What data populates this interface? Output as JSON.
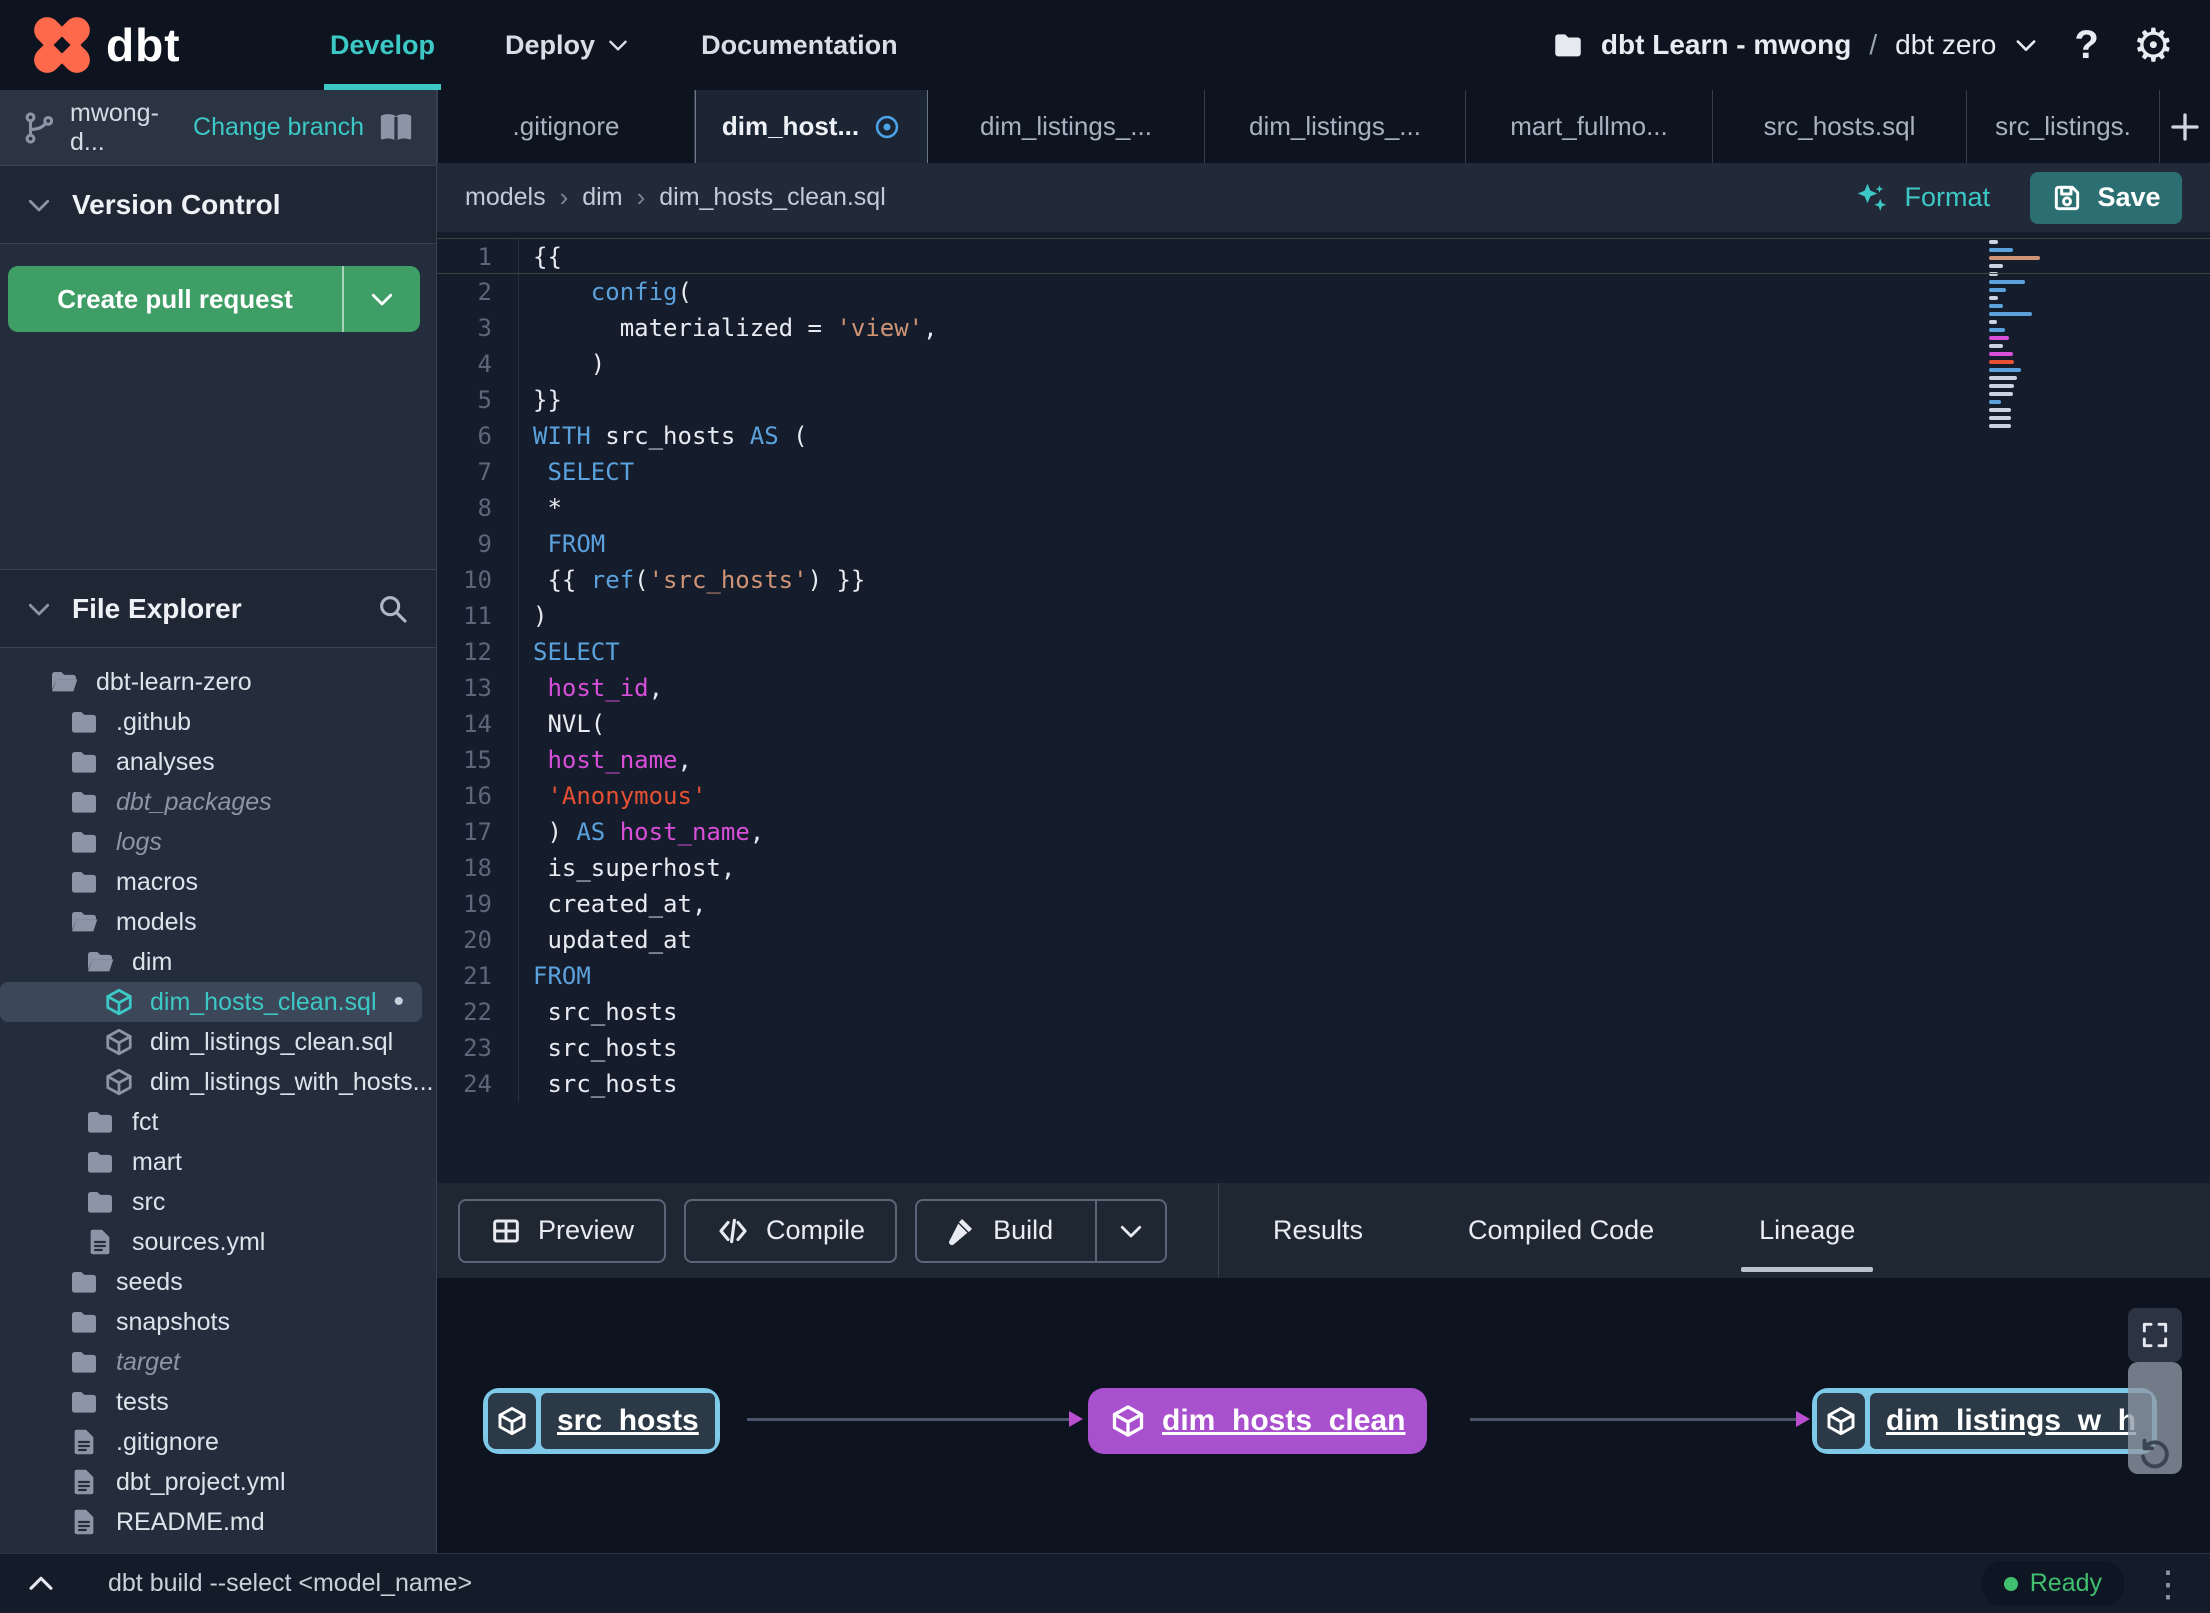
{
  "colors": {
    "accent_teal": "#3cc8c5",
    "green": "#3f9e66",
    "save_teal": "#2c6f72",
    "purple_node": "#a950ce",
    "blue_node": "#7ec8e8",
    "ready_green": "#3fbf6f",
    "keyword_blue": "#5ba2dd",
    "string_salmon": "#cf9475",
    "string_red": "#e55033",
    "identifier_magenta": "#d94fd9",
    "dirty_blue": "#4da3e8",
    "logo_orange": "#ff694b"
  },
  "topbar": {
    "brand": "dbt",
    "nav": [
      {
        "label": "Develop",
        "active": true,
        "dropdown": false
      },
      {
        "label": "Deploy",
        "active": false,
        "dropdown": true
      },
      {
        "label": "Documentation",
        "active": false,
        "dropdown": false
      }
    ],
    "project": {
      "account": "dbt Learn - mwong",
      "separator": "/",
      "name": "dbt zero"
    },
    "help": "?"
  },
  "sidebar": {
    "branch": {
      "name": "mwong-d...",
      "change_branch": "Change branch"
    },
    "version_control": {
      "title": "Version Control",
      "create_pr": "Create pull request"
    },
    "file_explorer": {
      "title": "File Explorer",
      "tree": [
        {
          "name": "dbt-learn-zero",
          "type": "folder-open",
          "level": 0
        },
        {
          "name": ".github",
          "type": "folder",
          "level": 1
        },
        {
          "name": "analyses",
          "type": "folder",
          "level": 1
        },
        {
          "name": "dbt_packages",
          "type": "folder",
          "level": 1,
          "italic": true
        },
        {
          "name": "logs",
          "type": "folder",
          "level": 1,
          "italic": true
        },
        {
          "name": "macros",
          "type": "folder",
          "level": 1
        },
        {
          "name": "models",
          "type": "folder-open",
          "level": 1
        },
        {
          "name": "dim",
          "type": "folder-open",
          "level": 2
        },
        {
          "name": "dim_hosts_clean.sql",
          "type": "model",
          "level": 3,
          "selected": true,
          "dirty": true
        },
        {
          "name": "dim_listings_clean.sql",
          "type": "model",
          "level": 3
        },
        {
          "name": "dim_listings_with_hosts...",
          "type": "model",
          "level": 3
        },
        {
          "name": "fct",
          "type": "folder",
          "level": 2
        },
        {
          "name": "mart",
          "type": "folder",
          "level": 2
        },
        {
          "name": "src",
          "type": "folder",
          "level": 2
        },
        {
          "name": "sources.yml",
          "type": "file",
          "level": 2
        },
        {
          "name": "seeds",
          "type": "folder",
          "level": 1
        },
        {
          "name": "snapshots",
          "type": "folder",
          "level": 1
        },
        {
          "name": "target",
          "type": "folder",
          "level": 1,
          "italic": true
        },
        {
          "name": "tests",
          "type": "folder",
          "level": 1
        },
        {
          "name": ".gitignore",
          "type": "file",
          "level": 1
        },
        {
          "name": "dbt_project.yml",
          "type": "file",
          "level": 1
        },
        {
          "name": "README.md",
          "type": "file",
          "level": 1
        }
      ]
    }
  },
  "tabs": [
    {
      "label": ".gitignore"
    },
    {
      "label": "dim_host...",
      "active": true,
      "dirty": true
    },
    {
      "label": "dim_listings_..."
    },
    {
      "label": "dim_listings_..."
    },
    {
      "label": "mart_fullmo..."
    },
    {
      "label": "src_hosts.sql"
    },
    {
      "label": "src_listings."
    }
  ],
  "editor": {
    "breadcrumb": [
      "models",
      "dim",
      "dim_hosts_clean.sql"
    ],
    "actions": {
      "format": "Format",
      "save": "Save"
    },
    "code": {
      "lines": [
        [
          [
            "{{",
            "plain"
          ]
        ],
        [
          [
            "    ",
            "plain"
          ],
          [
            "config",
            "kw"
          ],
          [
            "(",
            "plain"
          ]
        ],
        [
          [
            "      materialized = ",
            "plain"
          ],
          [
            "'view'",
            "str"
          ],
          [
            ",",
            "plain"
          ]
        ],
        [
          [
            "    )",
            "plain"
          ]
        ],
        [
          [
            "}}",
            "plain"
          ]
        ],
        [
          [
            "WITH",
            "kw"
          ],
          [
            " src_hosts ",
            "plain"
          ],
          [
            "AS",
            "kw"
          ],
          [
            " (",
            "plain"
          ]
        ],
        [
          [
            " ",
            "plain"
          ],
          [
            "SELECT",
            "kw"
          ]
        ],
        [
          [
            " *",
            "plain"
          ]
        ],
        [
          [
            " ",
            "plain"
          ],
          [
            "FROM",
            "kw"
          ]
        ],
        [
          [
            " {{ ",
            "plain"
          ],
          [
            "ref",
            "kw"
          ],
          [
            "(",
            "plain"
          ],
          [
            "'src_hosts'",
            "str"
          ],
          [
            ") }}",
            "plain"
          ]
        ],
        [
          [
            ")",
            "plain"
          ]
        ],
        [
          [
            "SELECT",
            "kw"
          ]
        ],
        [
          [
            " ",
            "plain"
          ],
          [
            "host_id",
            "ident"
          ],
          [
            ",",
            "plain"
          ]
        ],
        [
          [
            " NVL(",
            "plain"
          ]
        ],
        [
          [
            " ",
            "plain"
          ],
          [
            "host_name",
            "ident"
          ],
          [
            ",",
            "plain"
          ]
        ],
        [
          [
            " ",
            "plain"
          ],
          [
            "'Anonymous'",
            "red"
          ]
        ],
        [
          [
            " ) ",
            "plain"
          ],
          [
            "AS",
            "kw"
          ],
          [
            " ",
            "plain"
          ],
          [
            "host_name",
            "ident"
          ],
          [
            ",",
            "plain"
          ]
        ],
        [
          [
            " is_superhost,",
            "plain"
          ]
        ],
        [
          [
            " created_at,",
            "plain"
          ]
        ],
        [
          [
            " updated_at",
            "plain"
          ]
        ],
        [
          [
            "FROM",
            "kw"
          ]
        ],
        [
          [
            " src_hosts",
            "plain"
          ]
        ],
        [
          [
            " src_hosts",
            "plain"
          ]
        ],
        [
          [
            " src_hosts",
            "plain"
          ]
        ]
      ]
    }
  },
  "toolbar": {
    "buttons": {
      "preview": "Preview",
      "compile": "Compile",
      "build": "Build"
    },
    "result_tabs": [
      {
        "label": "Results"
      },
      {
        "label": "Compiled Code"
      },
      {
        "label": "Lineage",
        "active": true
      }
    ]
  },
  "lineage": {
    "nodes": [
      {
        "label": "src_hosts",
        "style": "source"
      },
      {
        "label": "dim_hosts_clean",
        "style": "selected"
      },
      {
        "label": "dim_listings_w_h",
        "style": "source"
      }
    ]
  },
  "statusbar": {
    "command": "dbt build --select <model_name>",
    "status": "Ready"
  }
}
